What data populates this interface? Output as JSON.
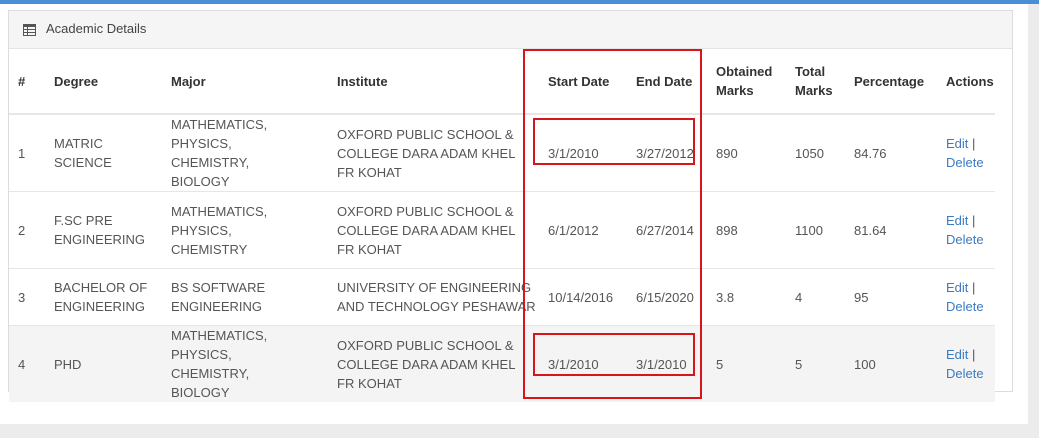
{
  "panel": {
    "title": "Academic Details",
    "icon": "table-icon"
  },
  "columns": [
    "#",
    "Degree",
    "Major",
    "Institute",
    "Start Date",
    "End Date",
    "Obtained Marks",
    "Total Marks",
    "Percentage",
    "Actions"
  ],
  "rows": [
    {
      "num": "1",
      "degree": "MATRIC SCIENCE",
      "major": "MATHEMATICS, PHYSICS, CHEMISTRY, BIOLOGY",
      "institute": "OXFORD PUBLIC SCHOOL & COLLEGE DARA ADAM KHEL FR KOHAT",
      "start": "3/1/2010",
      "end": "3/27/2012",
      "obtained": "890",
      "total": "1050",
      "percentage": "84.76",
      "edit": "Edit",
      "sep": "|",
      "delete": "Delete"
    },
    {
      "num": "2",
      "degree": "F.SC PRE ENGINEERING",
      "major": "MATHEMATICS, PHYSICS, CHEMISTRY",
      "institute": "OXFORD PUBLIC SCHOOL & COLLEGE DARA ADAM KHEL FR KOHAT",
      "start": "6/1/2012",
      "end": "6/27/2014",
      "obtained": "898",
      "total": "1100",
      "percentage": "81.64",
      "edit": "Edit",
      "sep": "|",
      "delete": "Delete"
    },
    {
      "num": "3",
      "degree": "BACHELOR OF ENGINEERING",
      "major": "BS SOFTWARE ENGINEERING",
      "institute": "UNIVERSITY OF ENGINEERING AND TECHNOLOGY PESHAWAR",
      "start": "10/14/2016",
      "end": "6/15/2020",
      "obtained": "3.8",
      "total": "4",
      "percentage": "95",
      "edit": "Edit",
      "sep": "|",
      "delete": "Delete"
    },
    {
      "num": "4",
      "degree": "PHD",
      "major": "MATHEMATICS, PHYSICS, CHEMISTRY, BIOLOGY",
      "institute": "OXFORD PUBLIC SCHOOL & COLLEGE DARA ADAM KHEL FR KOHAT",
      "start": "3/1/2010",
      "end": "3/1/2010",
      "obtained": "5",
      "total": "5",
      "percentage": "100",
      "edit": "Edit",
      "sep": "|",
      "delete": "Delete"
    }
  ],
  "colors": {
    "accent": "#4a8fd6",
    "link": "#3a7bbf",
    "highlight": "#d8151b",
    "stripe": "#f4f4f4"
  }
}
